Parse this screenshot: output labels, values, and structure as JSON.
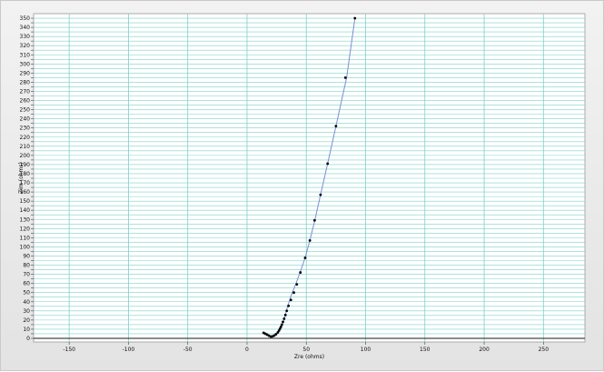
{
  "chart_data": {
    "type": "scatter",
    "title": "",
    "xlabel": "Zre (ohms)",
    "ylabel": "Zim (ohms)",
    "xlim": [
      -180,
      285
    ],
    "ylim": [
      -4,
      355
    ],
    "x_ticks": [
      -150,
      -100,
      -50,
      0,
      50,
      100,
      150,
      200,
      250
    ],
    "y_ticks": [
      0,
      5,
      10,
      15,
      20,
      25,
      30,
      35,
      40,
      45,
      50,
      55,
      60,
      65,
      70,
      75,
      80,
      85,
      90,
      95,
      100,
      105,
      110,
      115,
      120,
      125,
      130,
      135,
      140,
      145,
      150,
      155,
      160,
      165,
      170,
      175,
      180,
      185,
      190,
      195,
      200,
      205,
      210,
      215,
      220,
      225,
      230,
      235,
      240,
      245,
      250,
      255,
      260,
      265,
      270,
      275,
      280,
      285,
      290,
      295,
      300,
      305,
      310,
      315,
      320,
      325,
      330,
      335,
      340,
      345,
      350
    ],
    "y_tick_label_step": 10,
    "grid": true,
    "colors": {
      "grid": "#7fd0c7",
      "fit_line": "#7a8fd6",
      "points": "#000000",
      "plot_background": "#ffffff",
      "frame_background": "#e9e9e9"
    },
    "series": [
      {
        "type": "line",
        "x": [
          14,
          17,
          20,
          23,
          26,
          28,
          30,
          32,
          34,
          37,
          41,
          45,
          49,
          53,
          57,
          62,
          68,
          75,
          84,
          91
        ],
        "y": [
          6,
          4,
          2,
          3,
          6,
          10,
          16,
          24,
          34,
          46,
          59,
          73,
          88,
          107,
          128,
          157,
          191,
          232,
          285,
          350
        ]
      },
      {
        "type": "scatter",
        "x": [
          14,
          15.5,
          17,
          18.5,
          20,
          21.5,
          23,
          24.5,
          26,
          27,
          27.8,
          28.6,
          29.4,
          30.3,
          31.3,
          32.4,
          33.5,
          35,
          37,
          39.5,
          42,
          45,
          49,
          53,
          57,
          62,
          68,
          75,
          83,
          91
        ],
        "y": [
          6,
          5,
          4,
          2.8,
          2,
          2.2,
          3,
          4.5,
          6.5,
          8.5,
          10.5,
          12.5,
          15,
          18,
          21.5,
          25.5,
          30,
          35.5,
          42,
          50,
          59,
          72,
          88,
          107,
          129,
          157,
          191,
          232,
          285,
          350
        ]
      }
    ]
  }
}
